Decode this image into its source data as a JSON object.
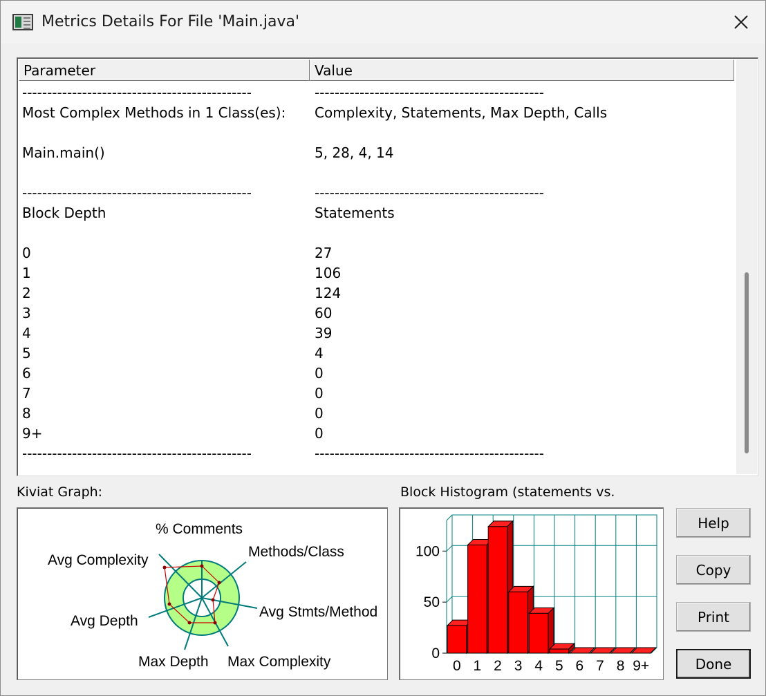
{
  "window": {
    "title": "Metrics Details For File 'Main.java'"
  },
  "list": {
    "columns": [
      "Parameter",
      "Value"
    ],
    "rows": [
      [
        "----------------------------------------------",
        "----------------------------------------------"
      ],
      [
        "Most Complex Methods in 1 Class(es):",
        "Complexity, Statements, Max Depth, Calls"
      ],
      [
        "",
        ""
      ],
      [
        "Main.main()",
        "5, 28, 4, 14"
      ],
      [
        "",
        ""
      ],
      [
        "----------------------------------------------",
        "----------------------------------------------"
      ],
      [
        "Block Depth",
        "Statements"
      ],
      [
        "",
        ""
      ],
      [
        "0",
        "27"
      ],
      [
        "1",
        "106"
      ],
      [
        "2",
        "124"
      ],
      [
        "3",
        "60"
      ],
      [
        "4",
        "39"
      ],
      [
        "5",
        "4"
      ],
      [
        "6",
        "0"
      ],
      [
        "7",
        "0"
      ],
      [
        "8",
        "0"
      ],
      [
        "9+",
        "0"
      ],
      [
        "----------------------------------------------",
        "----------------------------------------------"
      ]
    ]
  },
  "kiviat": {
    "label": "Kiviat Graph:",
    "axes": [
      "% Comments",
      "Methods/Class",
      "Avg Stmts/Method",
      "Max Complexity",
      "Max Depth",
      "Avg Depth",
      "Avg Complexity"
    ]
  },
  "histogram": {
    "label": "Block Histogram (statements vs.",
    "chart_data": {
      "type": "bar",
      "categories": [
        "0",
        "1",
        "2",
        "3",
        "4",
        "5",
        "6",
        "7",
        "8",
        "9+"
      ],
      "values": [
        27,
        106,
        124,
        60,
        39,
        4,
        0,
        0,
        0,
        0
      ],
      "yticks": [
        0,
        50,
        100
      ],
      "ylim": [
        0,
        130
      ],
      "bar_color": "#ff0000",
      "grid_color": "#008080"
    }
  },
  "buttons": {
    "help": "Help",
    "copy": "Copy",
    "print": "Print",
    "done": "Done"
  }
}
